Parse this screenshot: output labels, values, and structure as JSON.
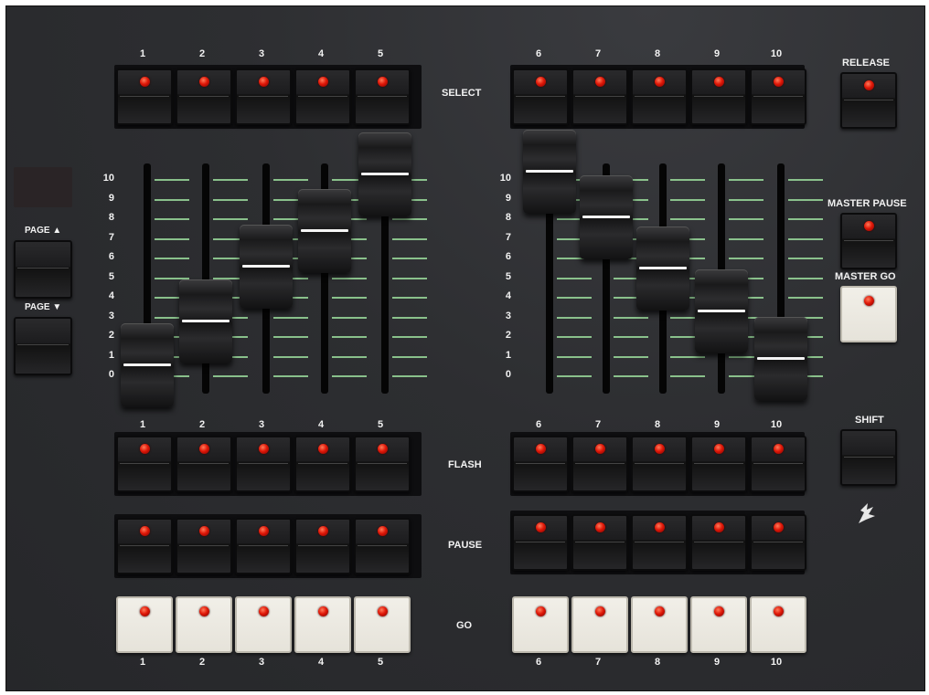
{
  "top_numbers": [
    "1",
    "2",
    "3",
    "4",
    "5",
    "6",
    "7",
    "8",
    "9",
    "10"
  ],
  "mid_numbers": [
    "1",
    "2",
    "3",
    "4",
    "5",
    "6",
    "7",
    "8",
    "9",
    "10"
  ],
  "bottom_numbers": [
    "1",
    "2",
    "3",
    "4",
    "5",
    "6",
    "7",
    "8",
    "9",
    "10"
  ],
  "scale": [
    "10",
    "9",
    "8",
    "7",
    "6",
    "5",
    "4",
    "3",
    "2",
    "1",
    "0"
  ],
  "labels": {
    "select": "SELECT",
    "release": "RELEASE",
    "master_pause": "MASTER PAUSE",
    "master_go": "MASTER GO",
    "page_up": "PAGE ▲",
    "page_down": "PAGE ▼",
    "flash": "FLASH",
    "pause": "PAUSE",
    "go": "GO",
    "shift": "SHIFT"
  },
  "fader_levels": [
    0.55,
    2.8,
    5.6,
    7.4,
    10.3,
    10.4,
    8.1,
    5.5,
    3.3,
    0.9
  ],
  "colors": {
    "panel": "#2d2e31",
    "led": "#e01808",
    "tick": "#9adb9b",
    "white_button": "#f1efe8"
  }
}
